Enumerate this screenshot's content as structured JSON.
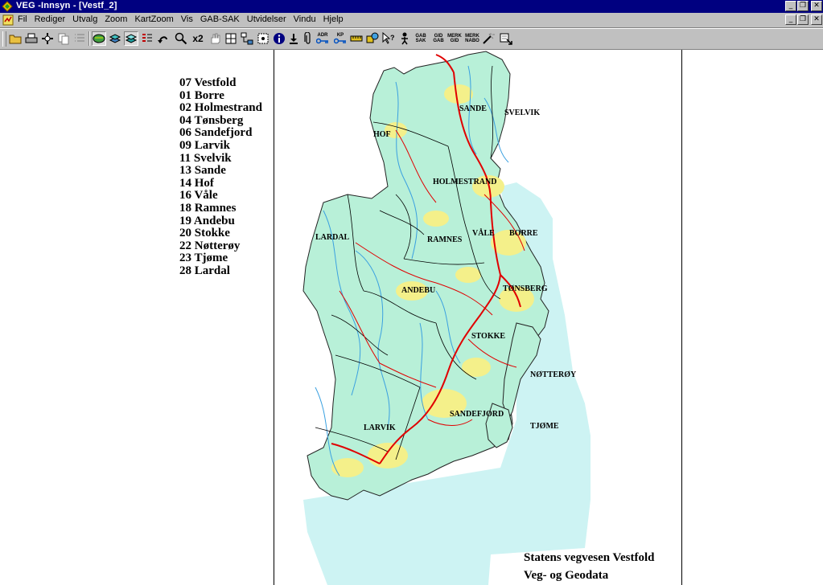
{
  "window": {
    "title": "VEG -Innsyn - [Vestf_2]",
    "controls": {
      "minimize": "_",
      "restore": "❐",
      "close": "✕"
    }
  },
  "menu": {
    "items": [
      "Fil",
      "Rediger",
      "Utvalg",
      "Zoom",
      "KartZoom",
      "Vis",
      "GAB-SAK",
      "Utvidelser",
      "Vindu",
      "Hjelp"
    ]
  },
  "toolbar": {
    "zoom2_label": "x2",
    "small_labels": {
      "adr": "ADR",
      "kp": "KP",
      "gab_sak": "GAB SAK",
      "gid_gab": "GID GAB",
      "merk_gid": "MERK GID",
      "merk_nabo": "MERK NABO"
    }
  },
  "legend": {
    "entries": [
      "07 Vestfold",
      "01 Borre",
      "02 Holmestrand",
      "04 Tønsberg",
      "06 Sandefjord",
      "09 Larvik",
      "11 Svelvik",
      "13 Sande",
      "14 Hof",
      "16 Våle",
      "18 Ramnes",
      "19 Andebu",
      "20 Stokke",
      "22 Nøtterøy",
      "23 Tjøme",
      "28 Lardal"
    ]
  },
  "map": {
    "labels": {
      "sande": "SANDE",
      "svelvik": "SVELVIK",
      "hof": "HOF",
      "holmestrand": "HOLMESTRAND",
      "lardal": "LARDAL",
      "ramnes": "RAMNES",
      "vale": "VÅLE",
      "borre": "BORRE",
      "andebu": "ANDEBU",
      "tonsberg": "TØNSBERG",
      "stokke": "STOKKE",
      "notteroy": "NØTTERØY",
      "sandefjord": "SANDEFJORD",
      "larvik": "LARVIK",
      "tjome": "TJØME"
    },
    "colors": {
      "land": "#b8f0d8",
      "sea": "#cdf3f3",
      "roads_main": "#e00000",
      "roads_minor": "#000000",
      "rivers": "#3aa0e0",
      "urban": "#f4f08a"
    }
  },
  "credit": {
    "line1": "Statens vegvesen Vestfold",
    "line2": "Veg- og Geodata"
  }
}
